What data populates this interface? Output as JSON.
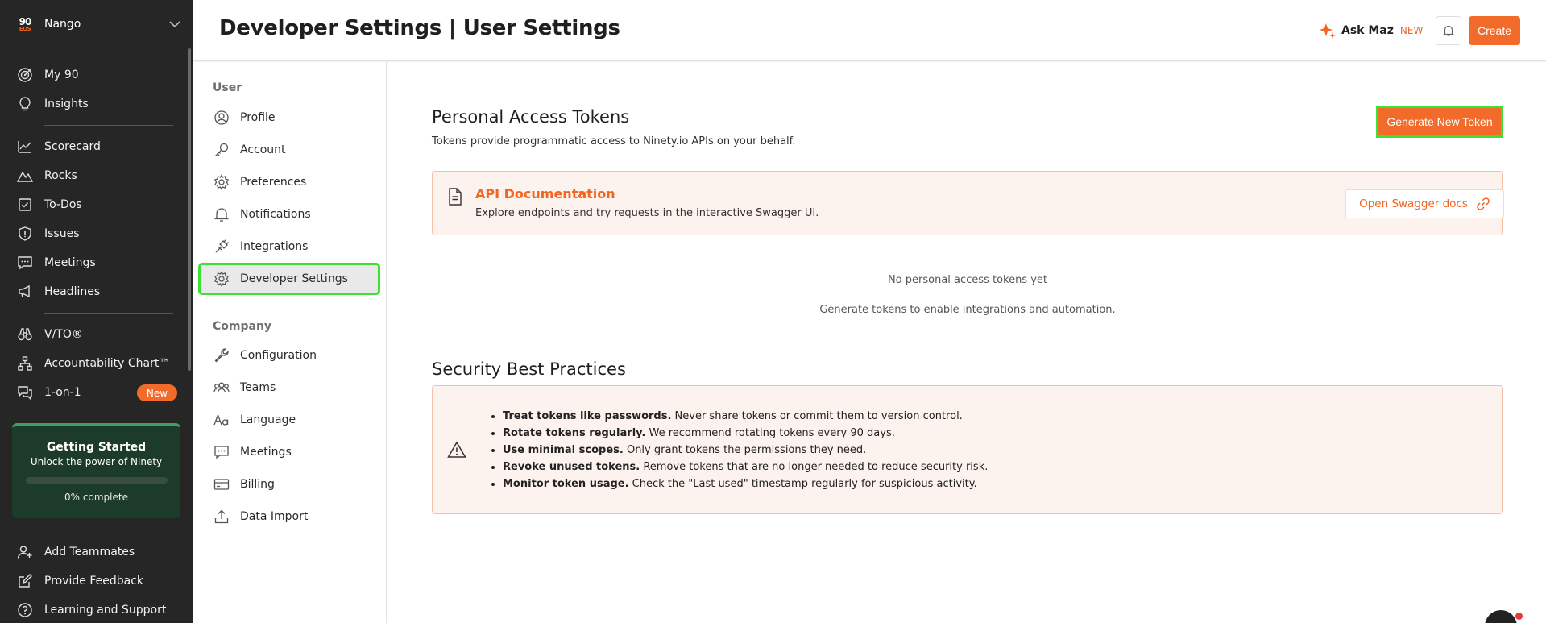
{
  "sidebar": {
    "org": {
      "logo_top": "90",
      "logo_bottom": "EOS",
      "name": "Nango"
    },
    "nav": [
      {
        "label": "My 90",
        "icon": "target-icon"
      },
      {
        "label": "Insights",
        "icon": "lightbulb-icon"
      },
      {
        "label": "Scorecard",
        "icon": "chart-line-icon"
      },
      {
        "label": "Rocks",
        "icon": "mountain-icon"
      },
      {
        "label": "To-Dos",
        "icon": "checkbox-icon"
      },
      {
        "label": "Issues",
        "icon": "shield-alert-icon"
      },
      {
        "label": "Meetings",
        "icon": "chat-dots-icon"
      },
      {
        "label": "Headlines",
        "icon": "megaphone-icon"
      },
      {
        "label": "V/TO®",
        "icon": "binoculars-icon"
      },
      {
        "label": "Accountability Chart™",
        "icon": "org-chart-icon"
      },
      {
        "label": "1-on-1",
        "icon": "conversation-icon",
        "badge": "New"
      }
    ],
    "getting_started": {
      "title": "Getting Started",
      "subtitle": "Unlock the power of Ninety",
      "progress": 0,
      "progress_label": "0% complete"
    },
    "footer": [
      {
        "label": "Add Teammates",
        "icon": "add-user-icon"
      },
      {
        "label": "Provide Feedback",
        "icon": "edit-icon"
      },
      {
        "label": "Learning and Support",
        "icon": "help-icon"
      }
    ]
  },
  "header": {
    "title": "Developer Settings | User Settings",
    "ask_maz": {
      "label": "Ask Maz",
      "badge": "NEW"
    },
    "create_label": "Create"
  },
  "subnav": {
    "user_section": "User",
    "user_items": [
      {
        "label": "Profile",
        "icon": "user-circle-icon"
      },
      {
        "label": "Account",
        "icon": "key-icon"
      },
      {
        "label": "Preferences",
        "icon": "gear-icon"
      },
      {
        "label": "Notifications",
        "icon": "bell-icon"
      },
      {
        "label": "Integrations",
        "icon": "plug-icon"
      },
      {
        "label": "Developer Settings",
        "icon": "gear-icon",
        "active": true
      }
    ],
    "company_section": "Company",
    "company_items": [
      {
        "label": "Configuration",
        "icon": "wrench-icon"
      },
      {
        "label": "Teams",
        "icon": "team-icon"
      },
      {
        "label": "Language",
        "icon": "font-icon"
      },
      {
        "label": "Meetings",
        "icon": "chat-dots-icon"
      },
      {
        "label": "Billing",
        "icon": "credit-card-icon"
      },
      {
        "label": "Data Import",
        "icon": "upload-icon"
      }
    ]
  },
  "main": {
    "tokens": {
      "title": "Personal Access Tokens",
      "description": "Tokens provide programmatic access to Ninety.io APIs on your behalf.",
      "generate_label": "Generate New Token"
    },
    "api_doc": {
      "title": "API Documentation",
      "description": "Explore endpoints and try requests in the interactive Swagger UI.",
      "button_label": "Open Swagger docs"
    },
    "empty": {
      "title": "No personal access tokens yet",
      "subtitle": "Generate tokens to enable integrations and automation."
    },
    "security": {
      "title": "Security Best Practices",
      "items": [
        {
          "bold": "Treat tokens like passwords.",
          "text": " Never share tokens or commit them to version control."
        },
        {
          "bold": "Rotate tokens regularly.",
          "text": " We recommend rotating tokens every 90 days."
        },
        {
          "bold": "Use minimal scopes.",
          "text": " Only grant tokens the permissions they need."
        },
        {
          "bold": "Revoke unused tokens.",
          "text": " Remove tokens that are no longer needed to reduce security risk."
        },
        {
          "bold": "Monitor token usage.",
          "text": " Check the \"Last used\" timestamp regularly for suspicious activity."
        }
      ]
    }
  },
  "colors": {
    "accent": "#f26b2a",
    "sidebar_bg": "#262626",
    "highlight": "#3be234",
    "card_bg": "#fdf3ee"
  }
}
